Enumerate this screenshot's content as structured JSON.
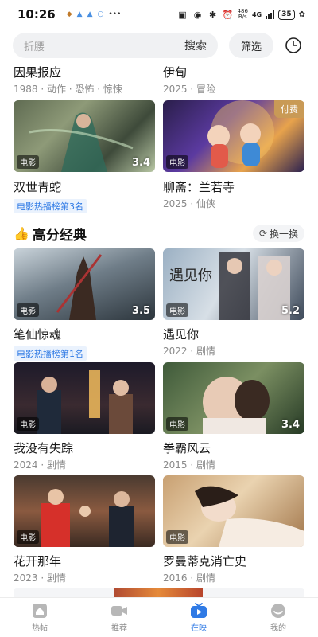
{
  "status_bar": {
    "time": "10:26",
    "net_speed": "486\nB/s",
    "network": "4G",
    "battery": "35"
  },
  "search": {
    "placeholder": "折腰",
    "search_label": "搜索",
    "filter_label": "筛选"
  },
  "top_items": [
    {
      "title": "因果报应",
      "meta": "1988 · 动作 · 恐怖 · 惊悚"
    },
    {
      "title": "伊甸",
      "meta": "2025 · 冒险"
    }
  ],
  "row1": [
    {
      "title": "双世青蛇",
      "rank": "电影热播榜第3名",
      "tag": "电影",
      "score": "3.4"
    },
    {
      "title": "聊斋：兰若寺",
      "meta": "2025 · 仙侠",
      "tag": "电影",
      "badge": "付费"
    }
  ],
  "section": {
    "title": "高分经典",
    "swap_label": "换一换"
  },
  "grid": [
    {
      "title": "笔仙惊魂",
      "rank": "电影热播榜第1名",
      "tag": "电影",
      "score": "3.5"
    },
    {
      "title": "遇见你",
      "meta": "2022 · 剧情",
      "tag": "电影",
      "score": "5.2"
    },
    {
      "title": "我没有失踪",
      "meta": "2024 · 剧情",
      "tag": "电影"
    },
    {
      "title": "拳霸风云",
      "meta": "2015 · 剧情",
      "tag": "电影",
      "score": "3.4"
    },
    {
      "title": "花开那年",
      "meta": "2023 · 剧情",
      "tag": "电影"
    },
    {
      "title": "罗曼蒂克消亡史",
      "meta": "2016 · 剧情",
      "tag": "电影"
    }
  ],
  "nav": [
    {
      "label": "热帖",
      "icon": "home-icon"
    },
    {
      "label": "推荐",
      "icon": "video-camera-icon"
    },
    {
      "label": "在映",
      "icon": "tv-icon",
      "active": true
    },
    {
      "label": "我的",
      "icon": "profile-icon"
    }
  ],
  "colors": {
    "accent": "#2f7ae5",
    "paid_badge": "#c99a56"
  }
}
